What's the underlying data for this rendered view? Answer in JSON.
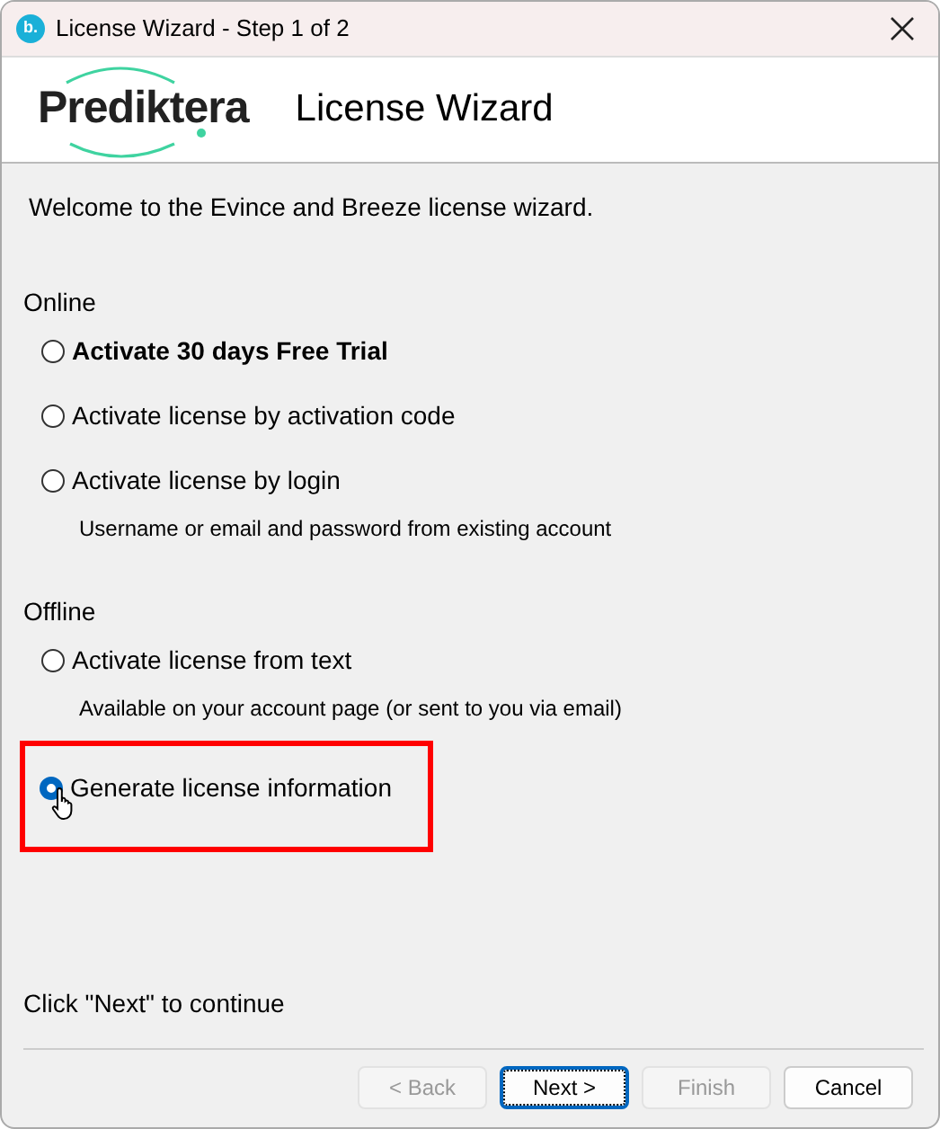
{
  "window": {
    "title": "License Wizard - Step 1 of 2",
    "app_icon_letter": "b."
  },
  "header": {
    "logo": "Prediktera",
    "title": "License Wizard"
  },
  "intro": "Welcome to the Evince and Breeze license wizard.",
  "groups": [
    {
      "title": "Online",
      "options": [
        {
          "label": "Activate 30 days Free Trial",
          "bold": true,
          "selected": false,
          "highlighted": false
        },
        {
          "label": "Activate license by activation code",
          "bold": false,
          "selected": false,
          "highlighted": false
        },
        {
          "label": "Activate license by login",
          "bold": false,
          "selected": false,
          "highlighted": false,
          "note": "Username or email and password from existing account"
        }
      ]
    },
    {
      "title": "Offline",
      "options": [
        {
          "label": "Activate license from text",
          "bold": false,
          "selected": false,
          "highlighted": false,
          "note": "Available on your account page (or sent to you via email)"
        },
        {
          "label": "Generate license information",
          "bold": false,
          "selected": true,
          "highlighted": true
        }
      ]
    }
  ],
  "footer_hint": "Click \"Next\" to continue",
  "buttons": [
    {
      "label": "< Back",
      "disabled": true,
      "focused": false
    },
    {
      "label": "Next >",
      "disabled": false,
      "focused": true
    },
    {
      "label": "Finish",
      "disabled": true,
      "focused": false
    },
    {
      "label": "Cancel",
      "disabled": false,
      "focused": false
    }
  ]
}
